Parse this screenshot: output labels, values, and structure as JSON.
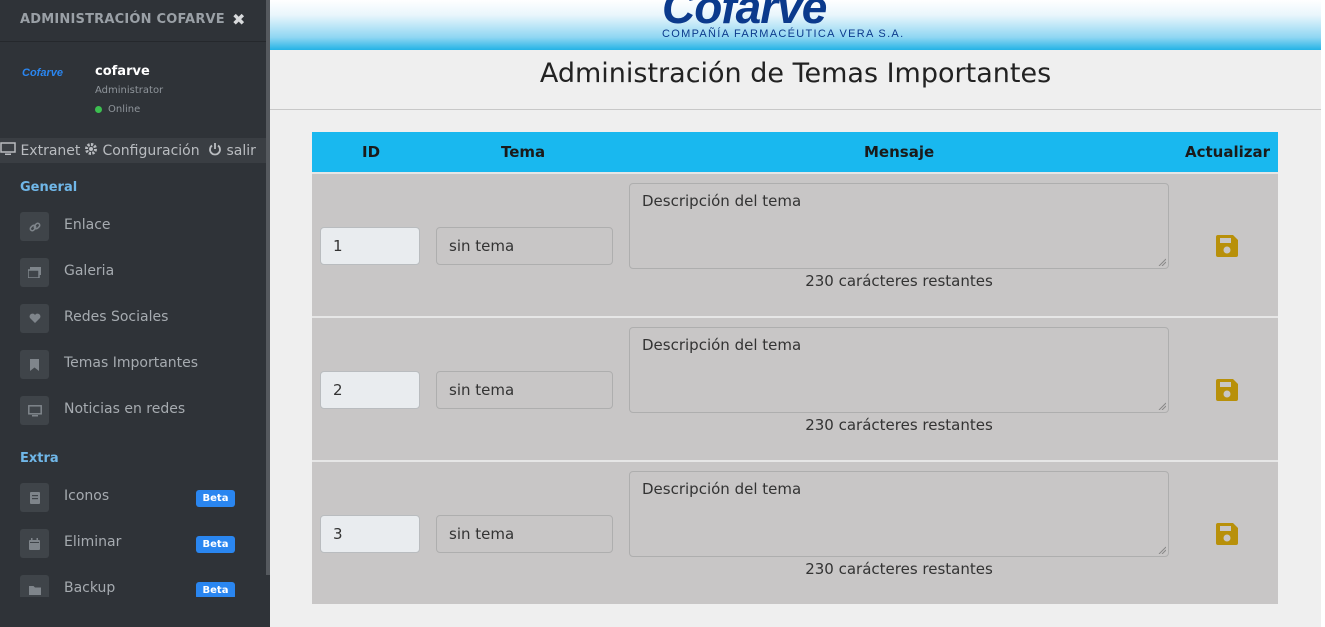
{
  "sidebar": {
    "title": "ADMINISTRACIÓN COFARVE",
    "close": "✖",
    "user": {
      "logo_text": "Cofarve",
      "name": "cofarve",
      "role": "Administrator",
      "status": "Online"
    },
    "links": [
      {
        "label": "Extranet",
        "icon": "monitor-icon"
      },
      {
        "label": "Configuración",
        "icon": "gear-icon"
      },
      {
        "label": "salir",
        "icon": "power-icon"
      }
    ],
    "sections": [
      {
        "title": "General"
      },
      {
        "title": "Extra"
      }
    ],
    "items": [
      {
        "label": "Enlace",
        "icon": "link-icon"
      },
      {
        "label": "Galeria",
        "icon": "images-icon"
      },
      {
        "label": "Redes Sociales",
        "icon": "heart-icon"
      },
      {
        "label": "Temas Importantes",
        "icon": "bookmark-icon"
      },
      {
        "label": "Noticias en redes",
        "icon": "desktop-icon"
      }
    ],
    "extra_items": [
      {
        "label": "Iconos",
        "icon": "book-icon",
        "badge": "Beta"
      },
      {
        "label": "Eliminar",
        "icon": "calendar-icon",
        "badge": "Beta"
      },
      {
        "label": "Backup",
        "icon": "folder-icon",
        "badge": "Beta"
      }
    ]
  },
  "header": {
    "brand": "Cofarve",
    "tagline": "COMPAÑÍA FARMACÉUTICA VERA S.A."
  },
  "page_title": "Administración de Temas Importantes",
  "table": {
    "headers": {
      "id": "ID",
      "tema": "Tema",
      "mensaje": "Mensaje",
      "actualizar": "Actualizar"
    },
    "rows": [
      {
        "id": "1",
        "tema": "sin tema",
        "mensaje": "Descripción del tema",
        "restantes": "230 carácteres restantes"
      },
      {
        "id": "2",
        "tema": "sin tema",
        "mensaje": "Descripción del tema",
        "restantes": "230 carácteres restantes"
      },
      {
        "id": "3",
        "tema": "sin tema",
        "mensaje": "Descripción del tema",
        "restantes": "230 carácteres restantes"
      }
    ]
  },
  "colors": {
    "sidebar_bg": "#2f3338",
    "table_header": "#19b8ef",
    "row_bg": "#c8c6c6",
    "save_icon": "#b8900a",
    "section_title": "#70b7e8",
    "badge": "#2a86f0"
  }
}
